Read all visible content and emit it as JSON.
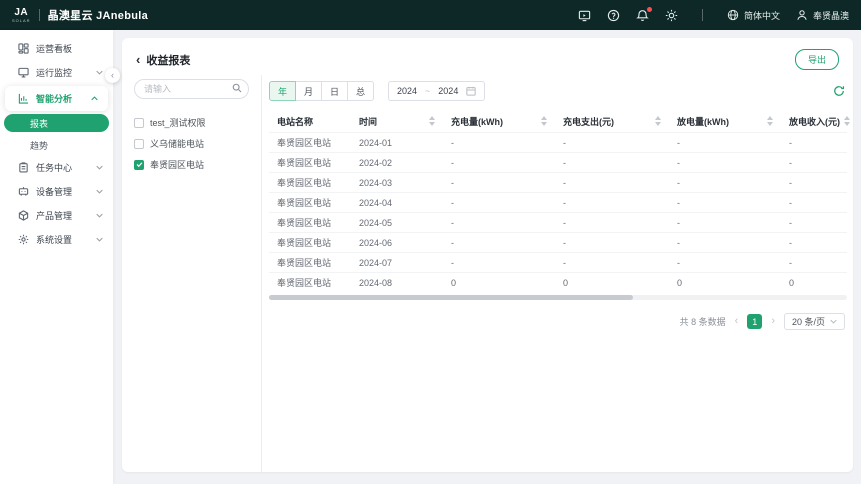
{
  "colors": {
    "primary": "#1fa26f",
    "topbar_bg": "#0d2826"
  },
  "topbar": {
    "logo_text": "JA",
    "logo_sub": "SOLAR",
    "brand": "晶澳星云 JAnebula",
    "icons": [
      "screen-icon",
      "help-icon",
      "bell-icon",
      "theme-icon"
    ],
    "language": "简体中文",
    "username": "奉贤晶澳"
  },
  "sidebar": {
    "items": [
      {
        "label": "运营看板",
        "icon": "dashboard-icon"
      },
      {
        "label": "运行监控",
        "icon": "monitor-icon",
        "expandable": true
      },
      {
        "label": "智能分析",
        "icon": "analysis-icon",
        "expandable": true,
        "expanded": true,
        "active": true,
        "children": [
          {
            "label": "报表",
            "active": true
          },
          {
            "label": "趋势",
            "active": false
          }
        ]
      },
      {
        "label": "任务中心",
        "icon": "task-icon",
        "expandable": true
      },
      {
        "label": "设备管理",
        "icon": "device-icon",
        "expandable": true
      },
      {
        "label": "产品管理",
        "icon": "product-icon",
        "expandable": true
      },
      {
        "label": "系统设置",
        "icon": "settings-icon",
        "expandable": true
      }
    ]
  },
  "page": {
    "title": "收益报表",
    "export_label": "导出"
  },
  "filter": {
    "search_placeholder": "请输入",
    "stations": [
      {
        "label": "test_测试权限",
        "checked": false
      },
      {
        "label": "义乌储能电站",
        "checked": false
      },
      {
        "label": "奉贤园区电站",
        "checked": true
      }
    ]
  },
  "controls": {
    "tabs": [
      "年",
      "月",
      "日",
      "总"
    ],
    "active_tab": "年",
    "date_from": "2024",
    "date_to": "2024",
    "range_separator": "~"
  },
  "table": {
    "columns": [
      {
        "label": "电站名称",
        "sortable": false
      },
      {
        "label": "时间",
        "sortable": true
      },
      {
        "label": "充电量(kWh)",
        "sortable": true
      },
      {
        "label": "充电支出(元)",
        "sortable": true
      },
      {
        "label": "放电量(kWh)",
        "sortable": true
      },
      {
        "label": "放电收入(元)",
        "sortable": true
      }
    ],
    "rows": [
      {
        "station": "奉贤园区电站",
        "time": "2024-01",
        "charge_kwh": "-",
        "charge_cost": "-",
        "discharge_kwh": "-",
        "discharge_income": "-"
      },
      {
        "station": "奉贤园区电站",
        "time": "2024-02",
        "charge_kwh": "-",
        "charge_cost": "-",
        "discharge_kwh": "-",
        "discharge_income": "-"
      },
      {
        "station": "奉贤园区电站",
        "time": "2024-03",
        "charge_kwh": "-",
        "charge_cost": "-",
        "discharge_kwh": "-",
        "discharge_income": "-"
      },
      {
        "station": "奉贤园区电站",
        "time": "2024-04",
        "charge_kwh": "-",
        "charge_cost": "-",
        "discharge_kwh": "-",
        "discharge_income": "-"
      },
      {
        "station": "奉贤园区电站",
        "time": "2024-05",
        "charge_kwh": "-",
        "charge_cost": "-",
        "discharge_kwh": "-",
        "discharge_income": "-"
      },
      {
        "station": "奉贤园区电站",
        "time": "2024-06",
        "charge_kwh": "-",
        "charge_cost": "-",
        "discharge_kwh": "-",
        "discharge_income": "-"
      },
      {
        "station": "奉贤园区电站",
        "time": "2024-07",
        "charge_kwh": "-",
        "charge_cost": "-",
        "discharge_kwh": "-",
        "discharge_income": "-"
      },
      {
        "station": "奉贤园区电站",
        "time": "2024-08",
        "charge_kwh": "0",
        "charge_cost": "0",
        "discharge_kwh": "0",
        "discharge_income": "0"
      }
    ]
  },
  "pagination": {
    "total_text": "共 8 条数据",
    "current_page": "1",
    "page_size": "20 条/页"
  }
}
